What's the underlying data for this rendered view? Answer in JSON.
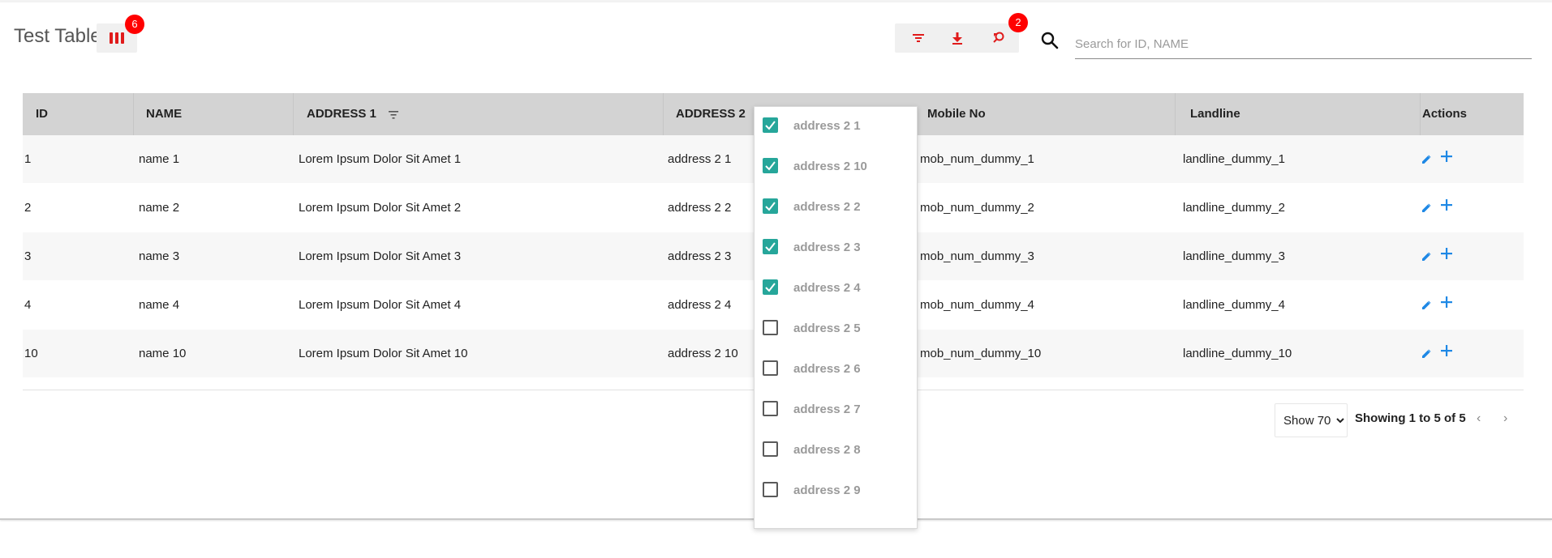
{
  "header": {
    "title": "Test Table",
    "columns_badge": "6",
    "reset_badge": "2",
    "search_placeholder": "Search for ID, NAME",
    "accent_color": "#ff0000"
  },
  "toolbar_icons": [
    "filter-icon",
    "download-icon",
    "reset-search-icon"
  ],
  "table": {
    "headers": [
      "ID",
      "NAME",
      "ADDRESS 1",
      "ADDRESS 2",
      "Mobile No",
      "Landline",
      "Actions"
    ],
    "rows": [
      [
        "1",
        "name 1",
        "Lorem Ipsum Dolor Sit Amet 1",
        "address 2 1",
        "mob_num_dummy_1",
        "landline_dummy_1"
      ],
      [
        "2",
        "name 2",
        "Lorem Ipsum Dolor Sit Amet 2",
        "address 2 2",
        "mob_num_dummy_2",
        "landline_dummy_2"
      ],
      [
        "3",
        "name 3",
        "Lorem Ipsum Dolor Sit Amet 3",
        "address 2 3",
        "mob_num_dummy_3",
        "landline_dummy_3"
      ],
      [
        "4",
        "name 4",
        "Lorem Ipsum Dolor Sit Amet 4",
        "address 2 4",
        "mob_num_dummy_4",
        "landline_dummy_4"
      ],
      [
        "10",
        "name 10",
        "Lorem Ipsum Dolor Sit Amet 10",
        "address 2 10",
        "mob_num_dummy_10",
        "landline_dummy_10"
      ]
    ]
  },
  "filter_dropdown": {
    "options": [
      {
        "label": "address 2 1",
        "checked": true
      },
      {
        "label": "address 2 10",
        "checked": true
      },
      {
        "label": "address 2 2",
        "checked": true
      },
      {
        "label": "address 2 3",
        "checked": true
      },
      {
        "label": "address 2 4",
        "checked": true
      },
      {
        "label": "address 2 5",
        "checked": false
      },
      {
        "label": "address 2 6",
        "checked": false
      },
      {
        "label": "address 2 7",
        "checked": false
      },
      {
        "label": "address 2 8",
        "checked": false
      },
      {
        "label": "address 2 9",
        "checked": false
      }
    ],
    "checked_color": "#26a69a"
  },
  "pagination": {
    "page_size_option": "Show 70",
    "info": "Showing 1 to 5 of 5"
  }
}
